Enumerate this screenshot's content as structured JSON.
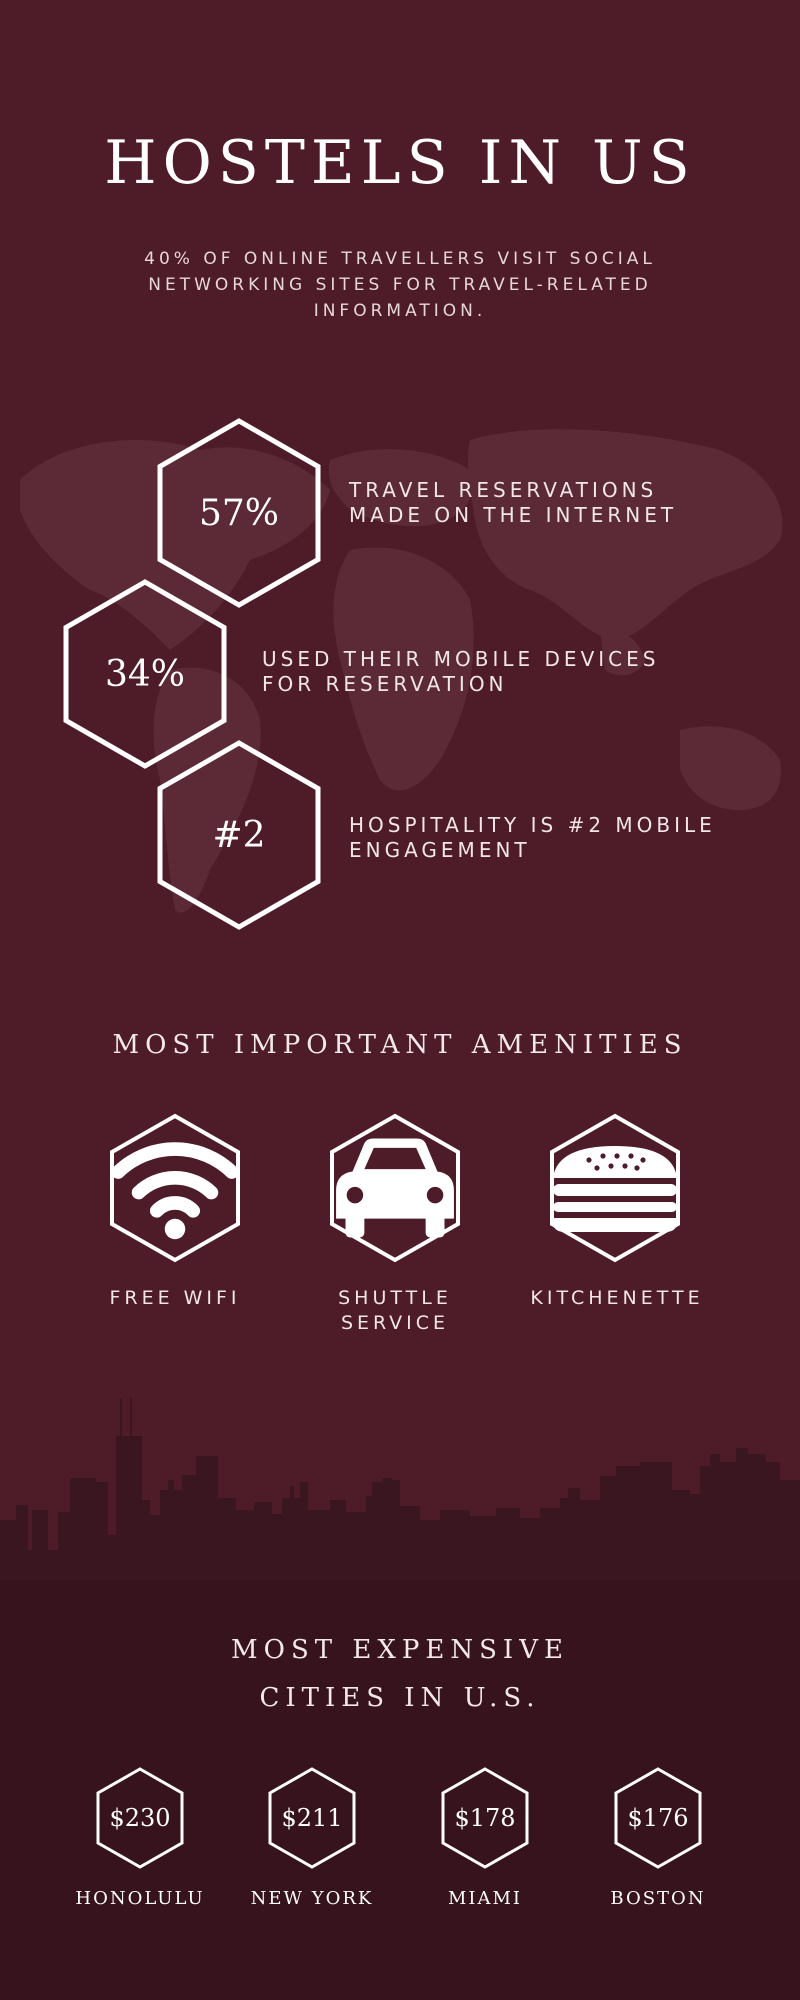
{
  "header": {
    "title": "HOSTELS IN US",
    "subtitle": "40% OF ONLINE TRAVELLERS VISIT SOCIAL NETWORKING SITES FOR TRAVEL-RELATED INFORMATION."
  },
  "stats": [
    {
      "value": "57%",
      "text": "TRAVEL RESERVATIONS MADE ON THE INTERNET"
    },
    {
      "value": "34%",
      "text": "USED THEIR MOBILE DEVICES FOR RESERVATION"
    },
    {
      "value": "#2",
      "text": "HOSPITALITY IS #2 MOBILE ENGAGEMENT"
    }
  ],
  "amenities": {
    "title": "MOST IMPORTANT AMENITIES",
    "items": [
      {
        "label": "FREE WIFI",
        "icon": "wifi-icon"
      },
      {
        "label": "SHUTTLE SERVICE",
        "icon": "car-icon"
      },
      {
        "label": "KITCHENETTE",
        "icon": "burger-icon"
      }
    ]
  },
  "cities": {
    "title_line1": "MOST EXPENSIVE",
    "title_line2": "CITIES IN U.S.",
    "items": [
      {
        "price": "$230",
        "name": "HONOLULU"
      },
      {
        "price": "$211",
        "name": "NEW YORK"
      },
      {
        "price": "$178",
        "name": "MIAMI"
      },
      {
        "price": "$176",
        "name": "BOSTON"
      }
    ]
  },
  "colors": {
    "background": "#4e1b28",
    "footer": "#37141d",
    "map": "#5c2a36",
    "skyline": "#3a1620",
    "text": "#ffffff"
  }
}
